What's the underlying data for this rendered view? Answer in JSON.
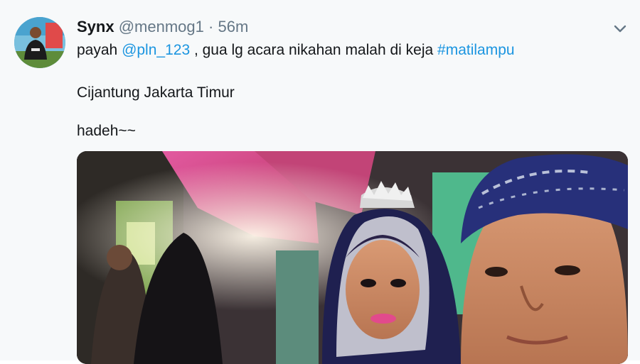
{
  "tweet": {
    "author_name": "Synx",
    "author_handle": "@menmog1",
    "separator": "·",
    "time": "56m",
    "text_prefix": "payah ",
    "mention": "@pln_123",
    "text_middle": " , gua lg acara nikahan malah di keja ",
    "hashtag": "#matilampu",
    "line2": "Cijantung Jakarta Timur",
    "line3": "hadeh~~"
  },
  "icons": {
    "menu": "chevron-down-icon",
    "avatar": "avatar"
  },
  "colors": {
    "link": "#1b95e0",
    "muted": "#657786",
    "background": "#f7f9fa"
  }
}
